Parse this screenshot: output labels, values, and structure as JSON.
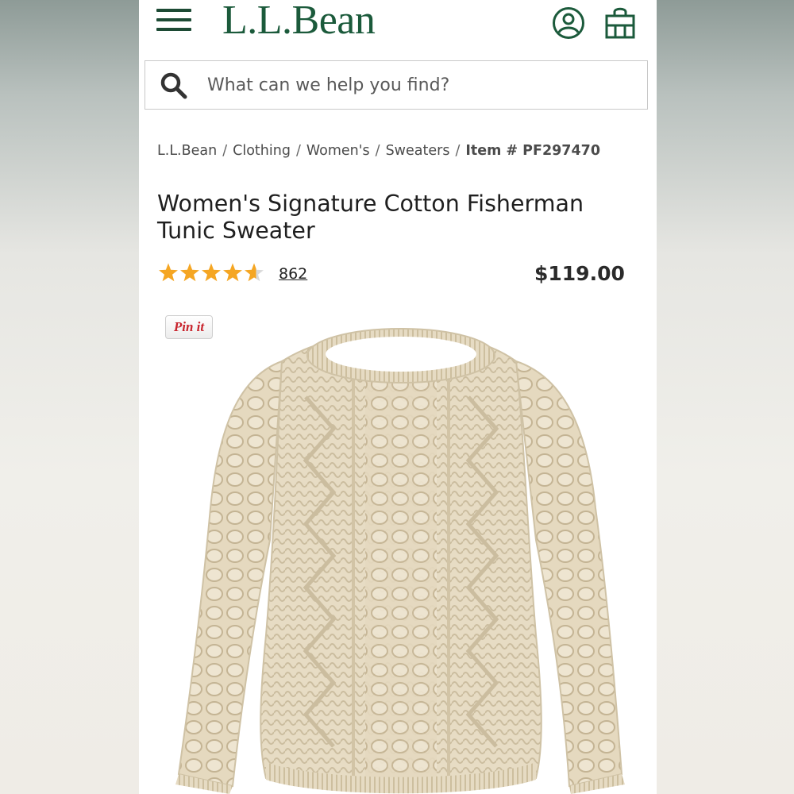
{
  "header": {
    "logo_text": "L.L.Bean",
    "brand_color": "#1b5a3b",
    "icons": [
      "menu-icon",
      "account-icon",
      "shopping-bag-icon"
    ]
  },
  "search": {
    "placeholder": "What can we help you find?",
    "value": ""
  },
  "breadcrumb": {
    "items": [
      "L.L.Bean",
      "Clothing",
      "Women's",
      "Sweaters"
    ],
    "separator": "/",
    "item_number": "Item # PF297470"
  },
  "product": {
    "title": "Women's Signature Cotton Fisherman Tunic Sweater",
    "rating": 4.6,
    "rating_max": 5,
    "review_count": "862",
    "price": "$119.00",
    "star_color": "#f5a623",
    "image_subject": "cream cable-knit fisherman tunic sweater"
  },
  "pinit": {
    "label": "Pin it"
  }
}
